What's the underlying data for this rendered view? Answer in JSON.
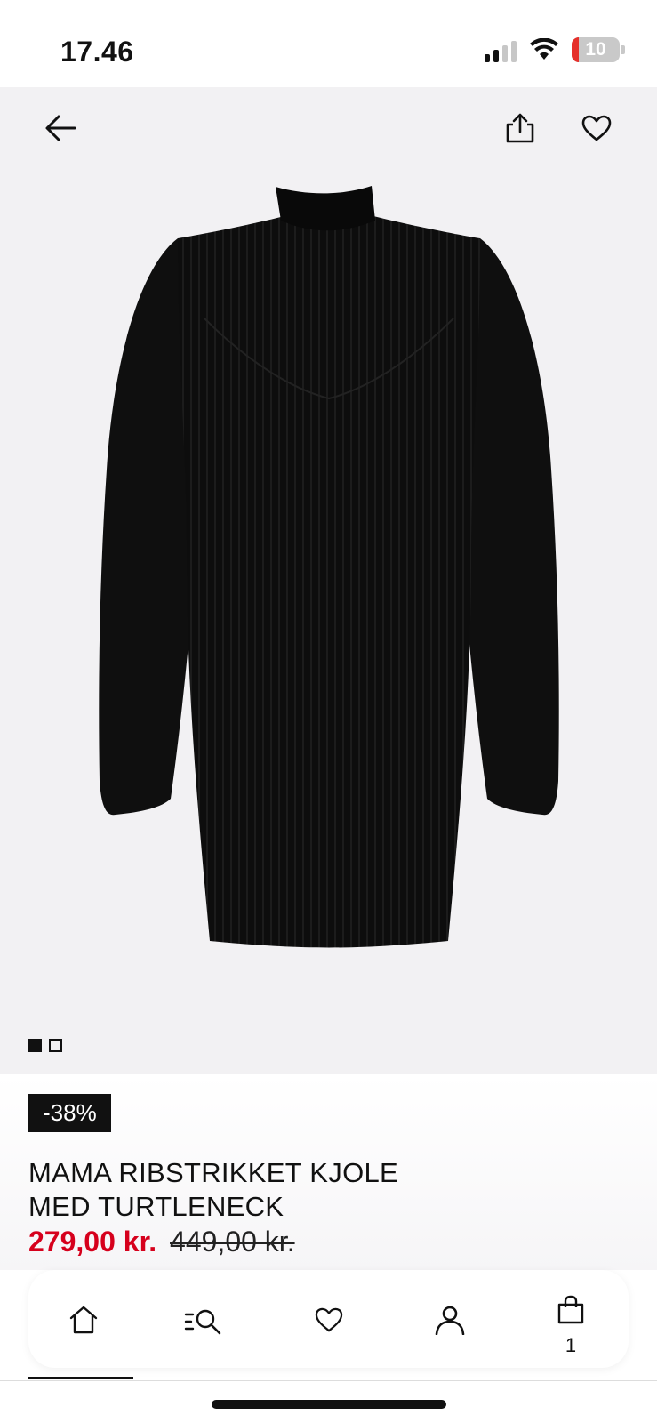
{
  "status_bar": {
    "time": "17.46",
    "battery_level": "10",
    "icons": [
      "signal-icon",
      "wifi-icon",
      "battery-icon"
    ]
  },
  "product": {
    "image_count": 2,
    "active_image": 1,
    "discount_badge": "-38%",
    "title_line1": "MAMA RIBSTRIKKET KJOLE",
    "title_line2": "MED TURTLENECK",
    "price_current": "279,00 kr.",
    "price_original": "449,00 kr."
  },
  "header_actions": {
    "back": "arrow-left-icon",
    "share": "share-icon",
    "favorite": "heart-icon"
  },
  "bottom_nav": {
    "items": [
      {
        "icon": "home-icon"
      },
      {
        "icon": "search-icon"
      },
      {
        "icon": "heart-icon"
      },
      {
        "icon": "account-icon"
      },
      {
        "icon": "bag-icon",
        "badge": "1"
      }
    ]
  },
  "colors": {
    "sale_red": "#d6001c",
    "hero_bg": "#f2f1f3",
    "badge_bg": "#111111"
  }
}
